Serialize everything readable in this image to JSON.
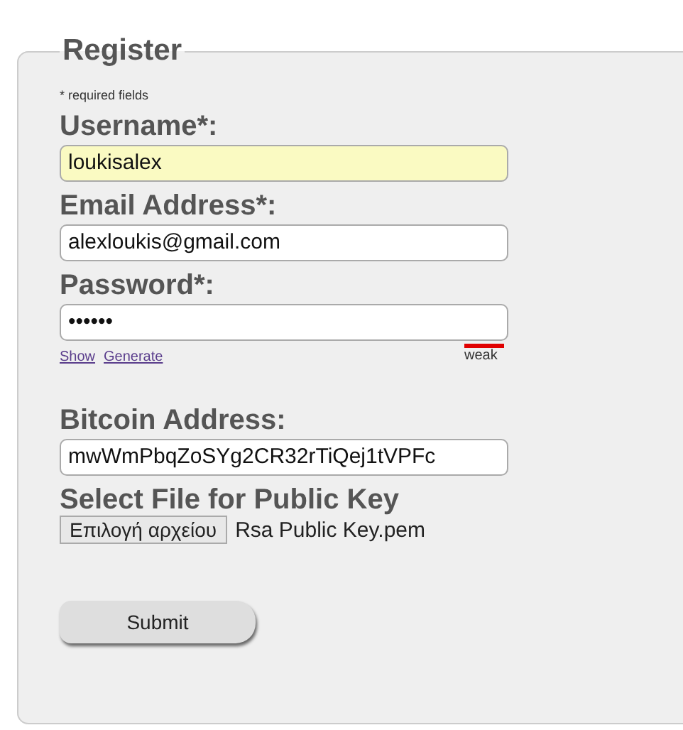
{
  "form": {
    "legend": "Register",
    "required_note": "* required fields",
    "fields": [
      {
        "label": "Username*:",
        "value": "loukisalex",
        "autofilled": true
      },
      {
        "label": "Email Address*:",
        "value": "alexloukis@gmail.com",
        "autofilled": false
      },
      {
        "label": "Password*:",
        "value": "••••••",
        "autofilled": false,
        "links": [
          "Show",
          "Generate"
        ],
        "strength": {
          "label": "weak"
        }
      },
      {
        "label": "Bitcoin Address:",
        "value": "mwWmPbqZoSYg2CR32rTiQej1tVPFc",
        "autofilled": false
      }
    ],
    "file": {
      "label": "Select File for Public Key",
      "button": "Επιλογή αρχείου",
      "filename": "Rsa Public Key.pem"
    },
    "submit": "Submit"
  }
}
